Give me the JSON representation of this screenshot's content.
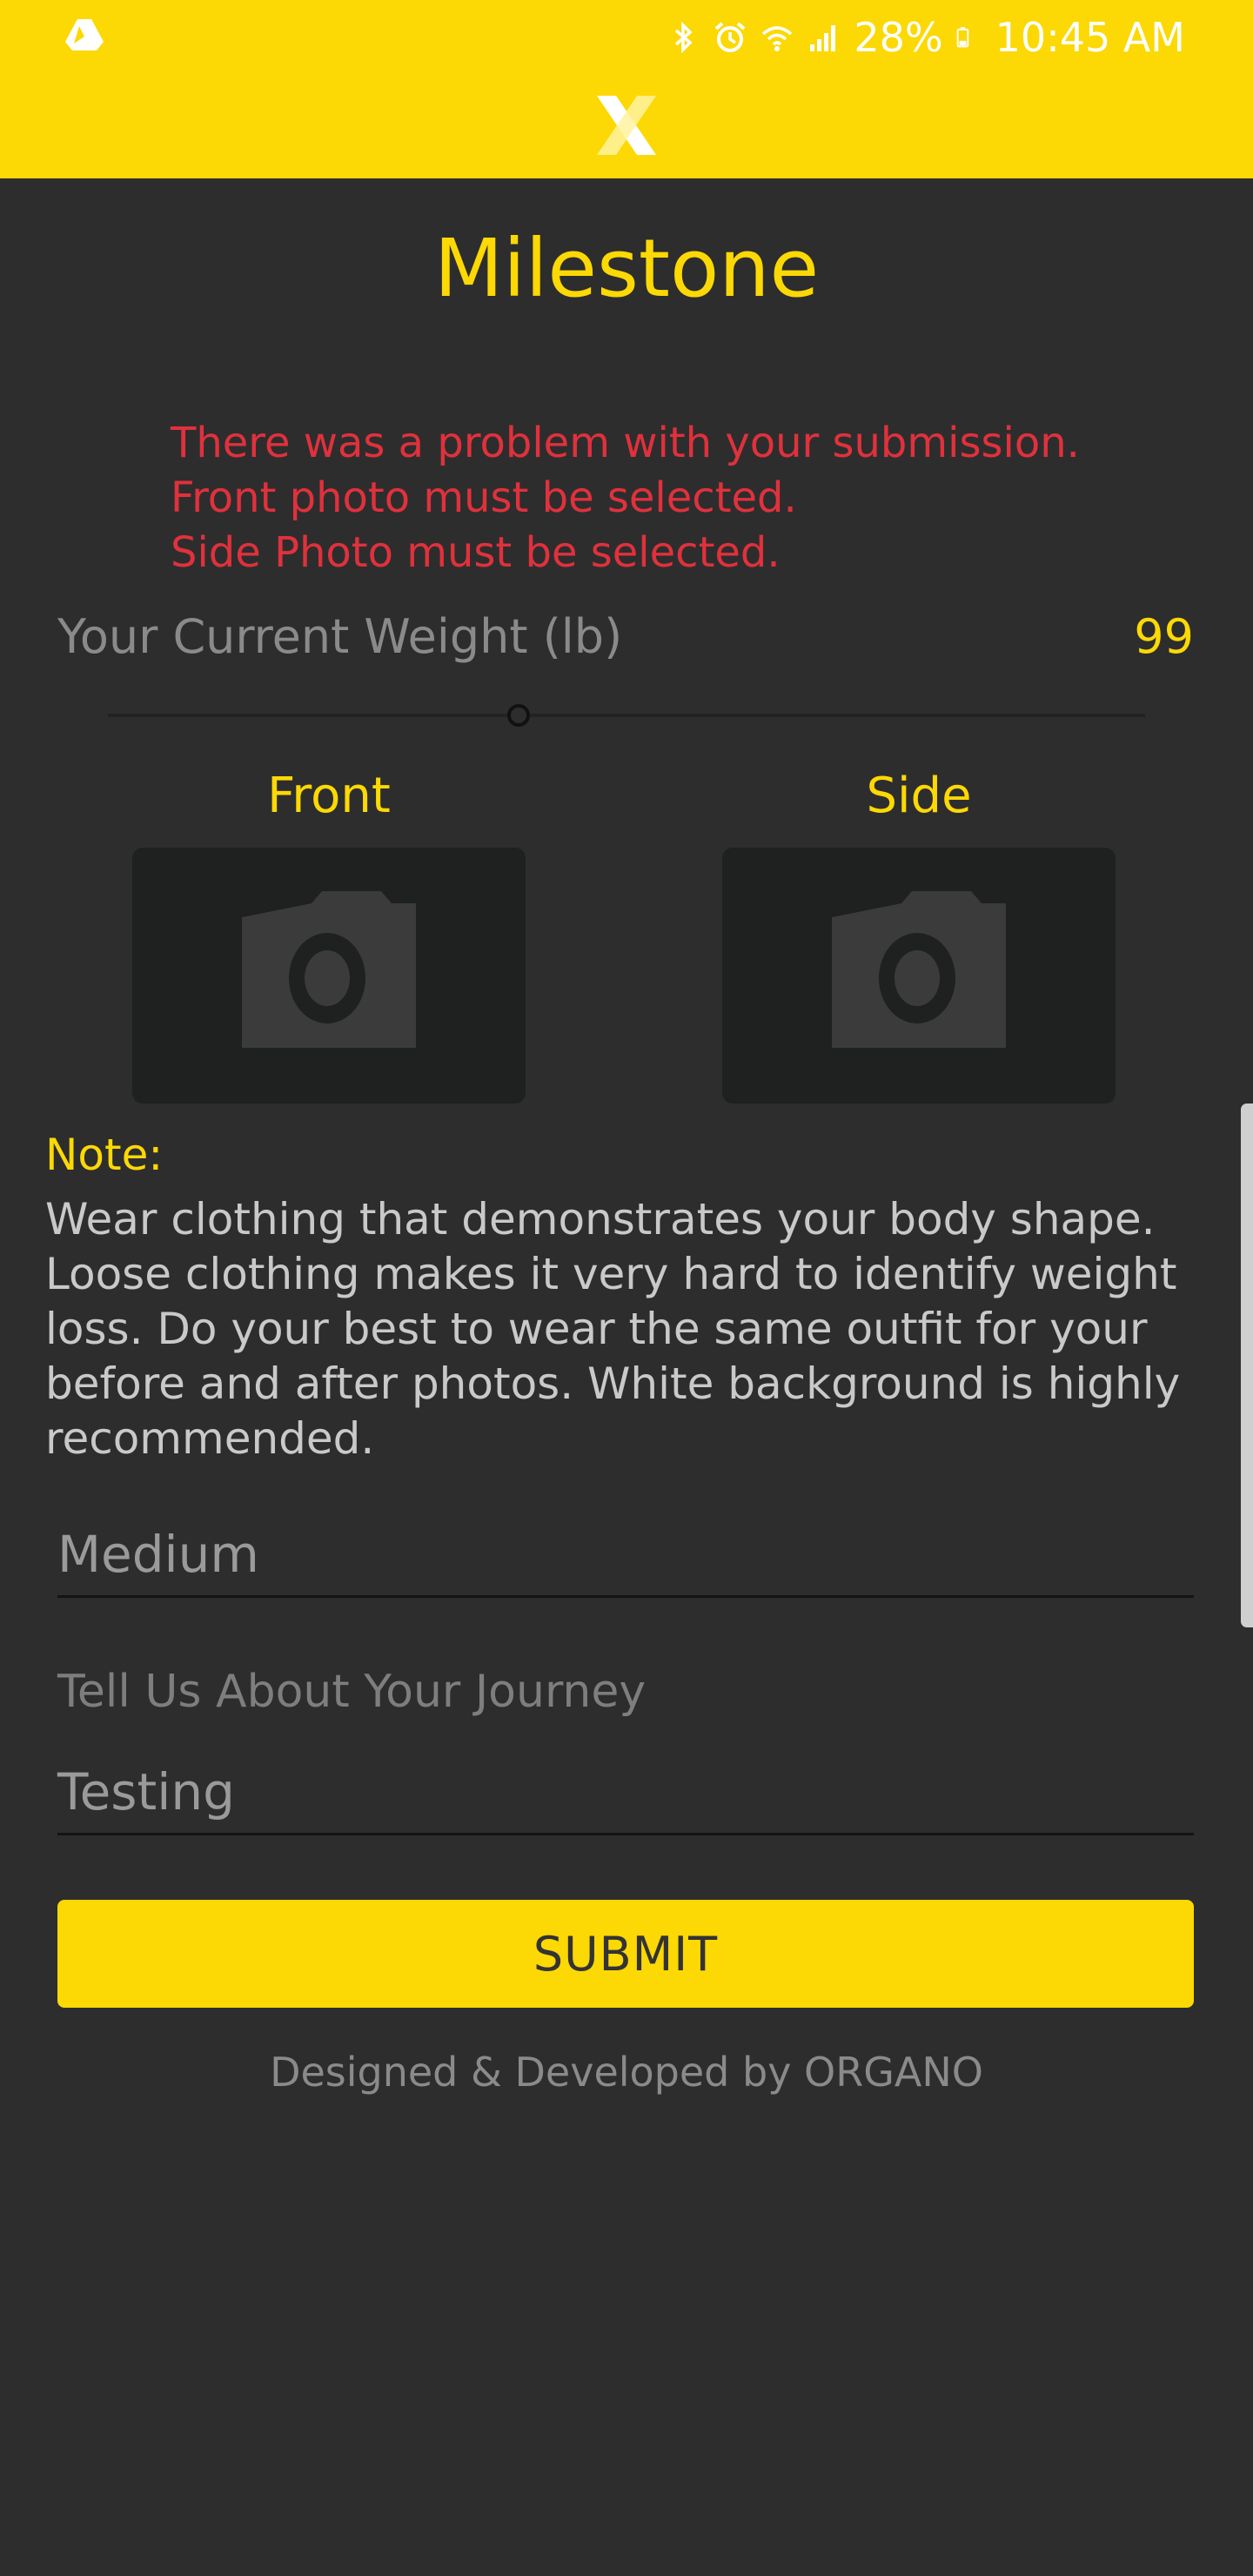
{
  "status_bar": {
    "battery": "28%",
    "time": "10:45 AM"
  },
  "header": {
    "logo": "X"
  },
  "page_title": "Milestone",
  "errors": [
    "There was a problem with your submission.",
    "Front photo must be selected.",
    "Side Photo must be selected."
  ],
  "weight": {
    "label": "Your Current Weight (lb)",
    "value": "99",
    "slider_fraction": 0.4
  },
  "photos": {
    "front_label": "Front",
    "side_label": "Side"
  },
  "note": {
    "label": "Note:",
    "text": "Wear clothing that demonstrates your body shape. Loose clothing makes it very hard to identify weight loss. Do your best to wear the same outfit for your before and after photos. White background is highly recommended."
  },
  "size_field": {
    "value": "Medium"
  },
  "journey": {
    "label": "Tell Us About Your Journey",
    "value": "Testing"
  },
  "submit_label": "SUBMIT",
  "footer": "Designed & Developed by ORGANO",
  "colors": {
    "accent": "#fcd805",
    "background": "#2d2d2e",
    "error": "#e0313c"
  }
}
